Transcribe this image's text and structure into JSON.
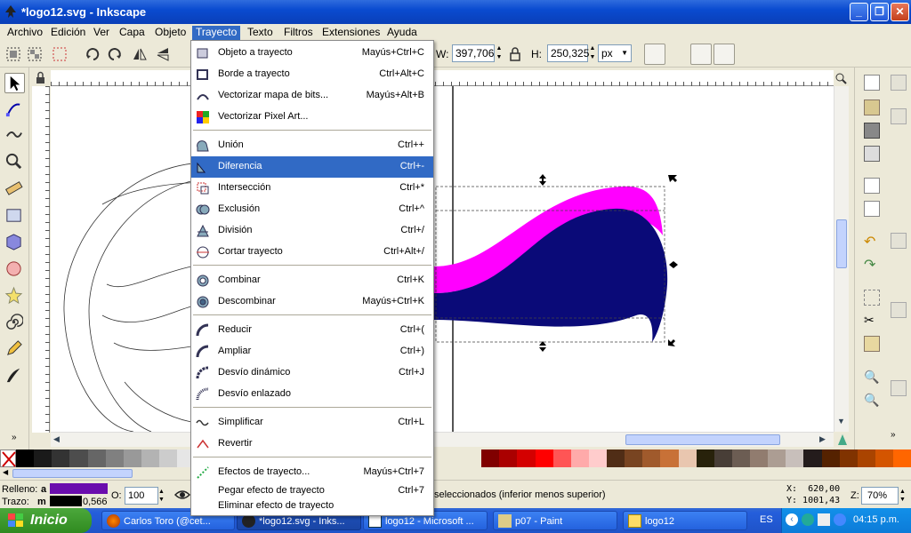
{
  "window": {
    "title": "*logo12.svg - Inkscape"
  },
  "menubar": {
    "items": [
      "Archivo",
      "Edición",
      "Ver",
      "Capa",
      "Objeto",
      "Trayecto",
      "Texto",
      "Filtros",
      "Extensiones",
      "Ayuda"
    ],
    "active": "Trayecto"
  },
  "toolbar": {
    "w_label": "W:",
    "w_value": "397,706",
    "h_label": "H:",
    "h_value": "250,325",
    "unit": "px"
  },
  "dropdown": {
    "items": [
      {
        "label": "Objeto a trayecto",
        "shortcut": "Mayús+Ctrl+C",
        "icon": "object-to-path-icon"
      },
      {
        "label": "Borde a trayecto",
        "shortcut": "Ctrl+Alt+C",
        "icon": "stroke-to-path-icon"
      },
      {
        "label": "Vectorizar mapa de bits...",
        "shortcut": "Mayús+Alt+B",
        "icon": "trace-bitmap-icon"
      },
      {
        "label": "Vectorizar Pixel Art...",
        "shortcut": "",
        "icon": "trace-pixel-art-icon"
      },
      {
        "label": "Unión",
        "shortcut": "Ctrl++",
        "icon": "union-icon"
      },
      {
        "label": "Diferencia",
        "shortcut": "Ctrl+-",
        "icon": "difference-icon"
      },
      {
        "label": "Intersección",
        "shortcut": "Ctrl+*",
        "icon": "intersection-icon"
      },
      {
        "label": "Exclusión",
        "shortcut": "Ctrl+^",
        "icon": "exclusion-icon"
      },
      {
        "label": "División",
        "shortcut": "Ctrl+/",
        "icon": "division-icon"
      },
      {
        "label": "Cortar trayecto",
        "shortcut": "Ctrl+Alt+/",
        "icon": "cut-path-icon"
      },
      {
        "label": "Combinar",
        "shortcut": "Ctrl+K",
        "icon": "combine-icon"
      },
      {
        "label": "Descombinar",
        "shortcut": "Mayús+Ctrl+K",
        "icon": "break-apart-icon"
      },
      {
        "label": "Reducir",
        "shortcut": "Ctrl+(",
        "icon": "inset-icon"
      },
      {
        "label": "Ampliar",
        "shortcut": "Ctrl+)",
        "icon": "outset-icon"
      },
      {
        "label": "Desvío dinámico",
        "shortcut": "Ctrl+J",
        "icon": "dynamic-offset-icon"
      },
      {
        "label": "Desvío enlazado",
        "shortcut": "",
        "icon": "linked-offset-icon"
      },
      {
        "label": "Simplificar",
        "shortcut": "Ctrl+L",
        "icon": "simplify-icon"
      },
      {
        "label": "Revertir",
        "shortcut": "",
        "icon": "reverse-icon"
      },
      {
        "label": "Efectos de trayecto...",
        "shortcut": "Mayús+Ctrl+7",
        "icon": "path-effects-icon"
      },
      {
        "label": "Pegar efecto de trayecto",
        "shortcut": "Ctrl+7",
        "icon": "none"
      },
      {
        "label": "Eliminar efecto de trayecto",
        "shortcut": "",
        "icon": "none"
      }
    ],
    "highlighted": "Diferencia"
  },
  "status": {
    "fill_label": "Relleno:",
    "fill_value": "a",
    "stroke_label": "Trazo:",
    "stroke_value": "m",
    "stroke_width": "0,566",
    "opacity_label": "O:",
    "opacity_value": "100",
    "message": "seleccionados (inferior menos superior)",
    "x_coord": "X:  620,00",
    "y_coord": "Y: 1001,43",
    "zoom_label": "Z:",
    "zoom_value": "70%",
    "fill_color": "#6a0dad",
    "stroke_color": "#000000"
  },
  "taskbar": {
    "start_label": "Inicio",
    "buttons": [
      "Carlos Toro (@cet...",
      "*logo12.svg - Inks...",
      "logo12 - Microsoft ...",
      "p07 - Paint",
      "logo12"
    ],
    "lang": "ES",
    "time": "04:15 p.m."
  },
  "colors": {
    "accent": "#316ac5",
    "magenta_shape": "#ff00ff",
    "navy_shape": "#0a0a78"
  }
}
